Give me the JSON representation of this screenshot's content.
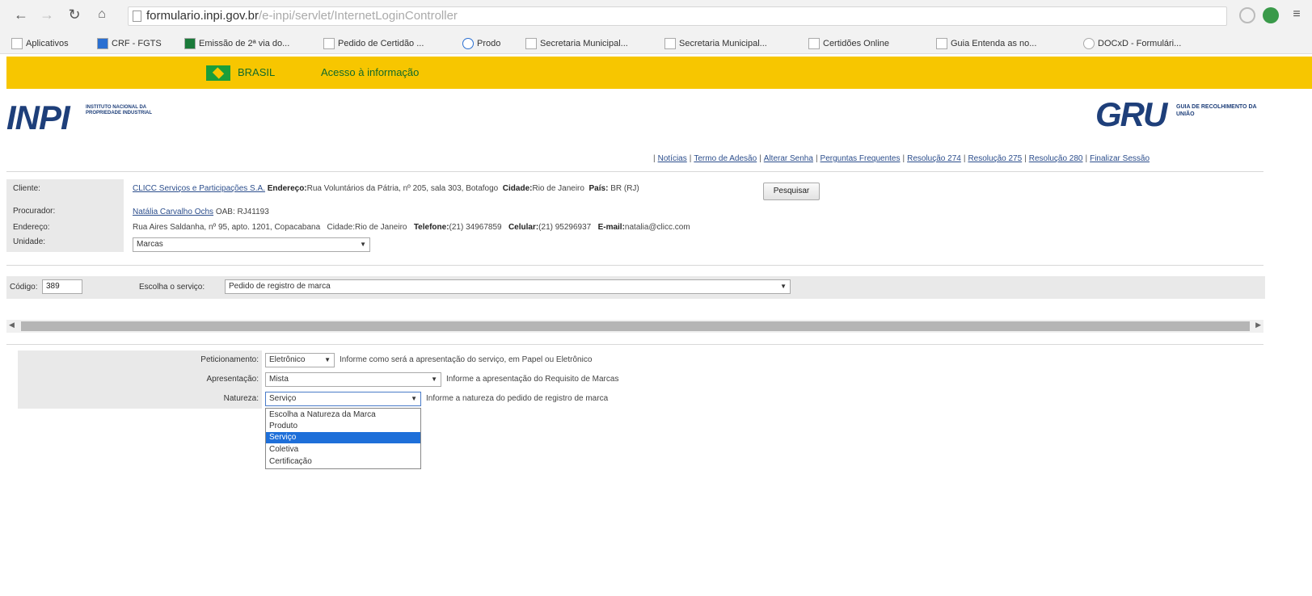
{
  "browser": {
    "url_host": "formulario.inpi.gov.br",
    "url_path": "/e-inpi/servlet/InternetLoginController",
    "bookmarks": [
      "Aplicativos",
      "CRF - FGTS",
      "Emissão de 2ª via do...",
      "Pedido de Certidão ...",
      "Prodo",
      "Secretaria Municipal...",
      "Secretaria Municipal...",
      "Certidões Online",
      "Guia Entenda as no...",
      "DOCxD - Formulári..."
    ]
  },
  "govbar": {
    "brasil_label": "BRASIL",
    "access_label": "Acesso à informação"
  },
  "header": {
    "inpi_logo_text": "INPI",
    "inpi_subtitle": "INSTITUTO NACIONAL DA PROPRIEDADE INDUSTRIAL",
    "gru_logo_text": "GRU",
    "gru_subtitle": "GUIA DE RECOLHIMENTO DA UNIÃO",
    "links": [
      "Notícias",
      "Termo de Adesão",
      "Alterar Senha",
      "Perguntas Frequentes",
      "Resolução 274",
      "Resolução 275",
      "Resolução 280",
      "Finalizar Sessão"
    ]
  },
  "client": {
    "label_cliente": "Cliente:",
    "label_procurador": "Procurador:",
    "label_endereco": "Endereço:",
    "label_unidade": "Unidade:",
    "cliente_name": "CLICC Serviços e Participações S.A.",
    "cliente_endereco_label": "Endereço:",
    "cliente_endereco": "Rua Voluntários da Pátria, nº 205, sala 303, Botafogo",
    "cliente_cidade_label": "Cidade:",
    "cliente_cidade": "Rio de Janeiro",
    "cliente_uf_label": "País:",
    "cliente_uf": "BR (RJ)",
    "pesquisar_button": "Pesquisar",
    "procurador_name": "Natália Carvalho Ochs",
    "procurador_oab": "OAB: RJ41193",
    "procurador_endereco": "Rua Aires Saldanha, nº 95, apto. 1201, Copacabana",
    "procurador_cidade": "Cidade:Rio de Janeiro",
    "telefone_label": "Telefone:",
    "telefone": "(21) 34967859",
    "celular_label": "Celular:",
    "celular": "(21) 95296937",
    "email_label": "E-mail:",
    "email": "natalia@clicc.com",
    "unidade_value": "Marcas"
  },
  "service": {
    "codigo_label": "Código:",
    "codigo_value": "389",
    "escolha_label": "Escolha o serviço:",
    "escolha_value": "Pedido de registro de marca"
  },
  "form": {
    "peticionamento_label": "Peticionamento:",
    "peticionamento_value": "Eletrônico",
    "peticionamento_hint": "Informe como será a apresentação do serviço, em Papel ou Eletrônico",
    "apresentacao_label": "Apresentação:",
    "apresentacao_value": "Mista",
    "apresentacao_hint": "Informe a apresentação do Requisito de Marcas",
    "natureza_label": "Natureza:",
    "natureza_value": "Serviço",
    "natureza_hint": "Informe a natureza do pedido de registro de marca",
    "natureza_options": [
      "Escolha a Natureza da Marca",
      "Produto",
      "Serviço",
      "Coletiva",
      "Certificação"
    ],
    "natureza_selected_index": 2
  },
  "colors": {
    "gov_yellow": "#f7c600",
    "brand_blue": "#1e3f7a",
    "selection_blue": "#1e6fd9"
  }
}
